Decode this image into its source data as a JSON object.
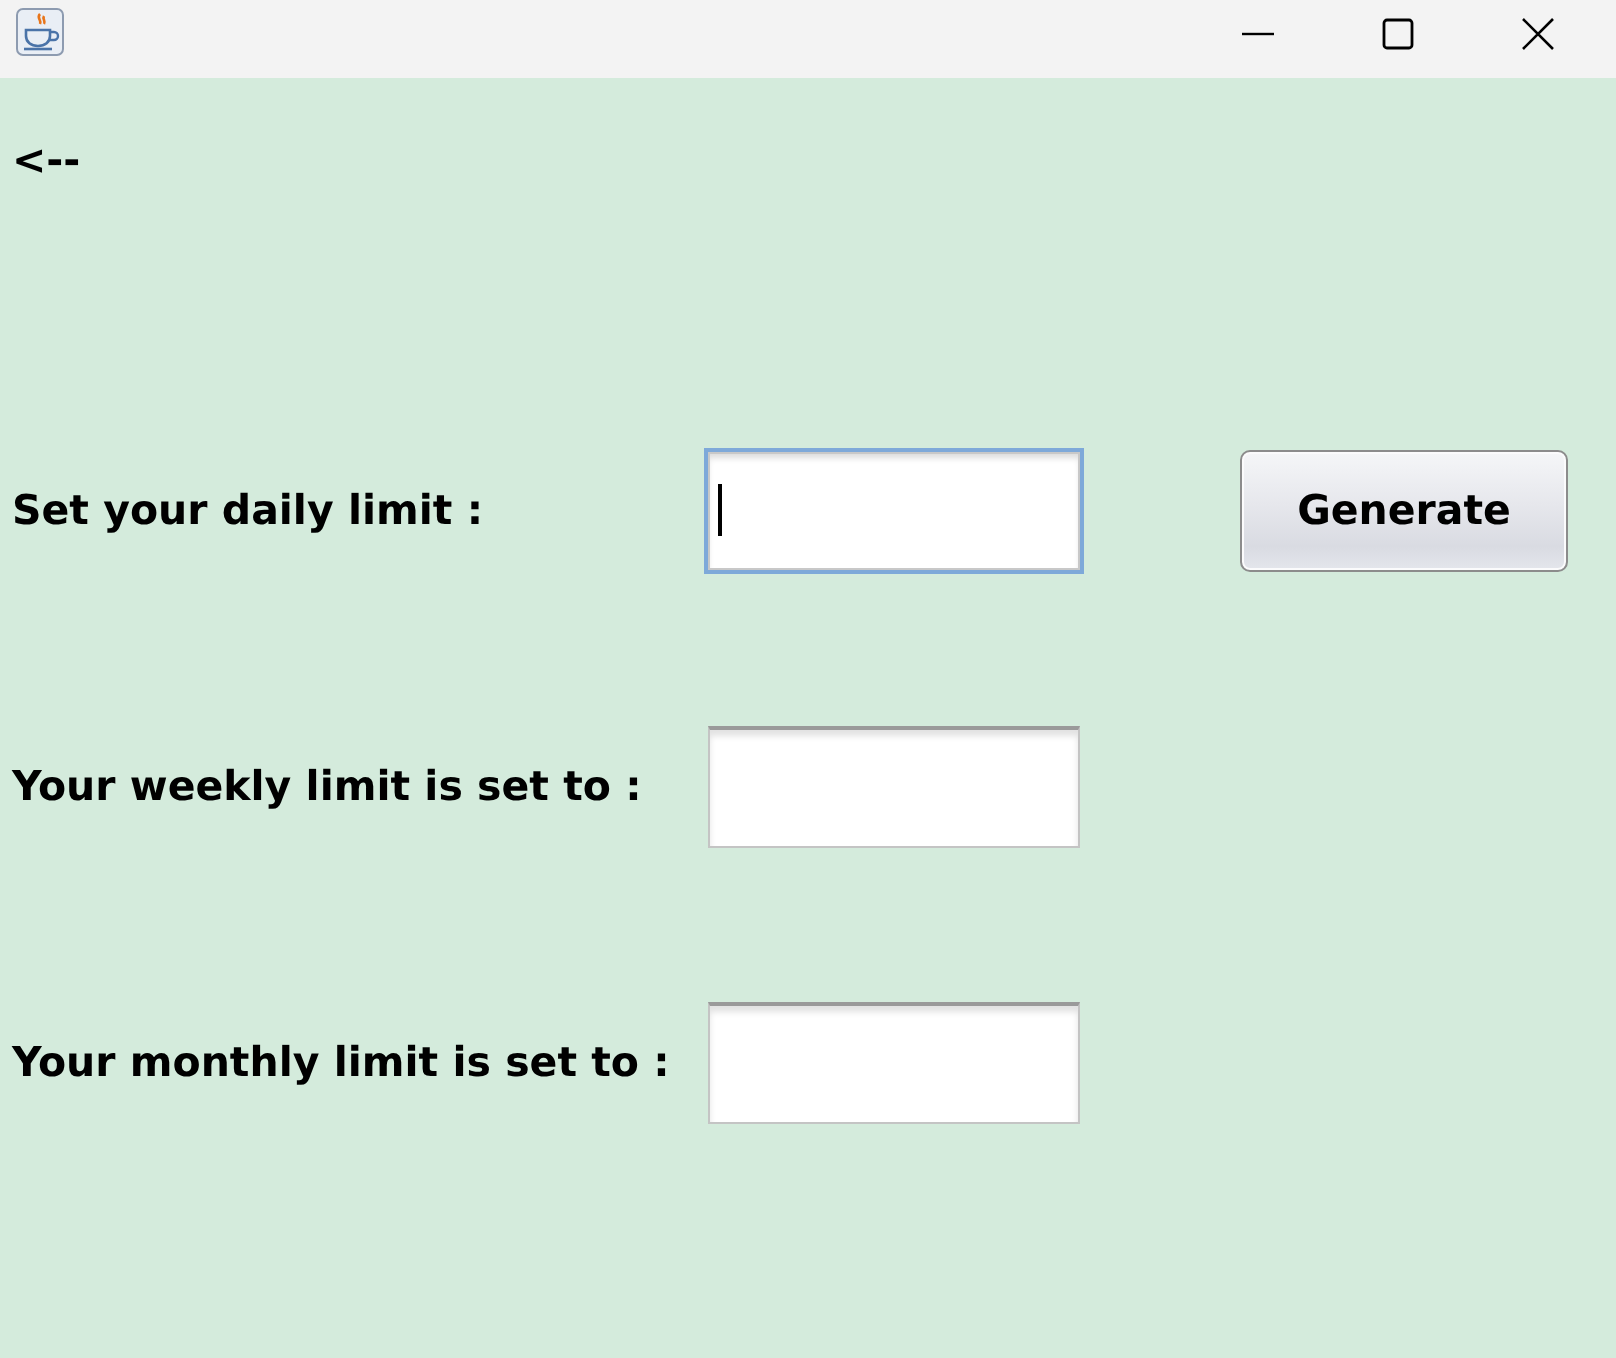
{
  "back_link": {
    "label": "<--"
  },
  "rows": [
    {
      "label": "Set your daily limit :",
      "field": {
        "focused": true
      },
      "button": {
        "label": "Generate"
      }
    },
    {
      "label": "Your weekly limit is set to :",
      "field": {
        "focused": false
      }
    },
    {
      "label": "Your monthly limit is set to :",
      "field": {
        "focused": false
      }
    }
  ]
}
